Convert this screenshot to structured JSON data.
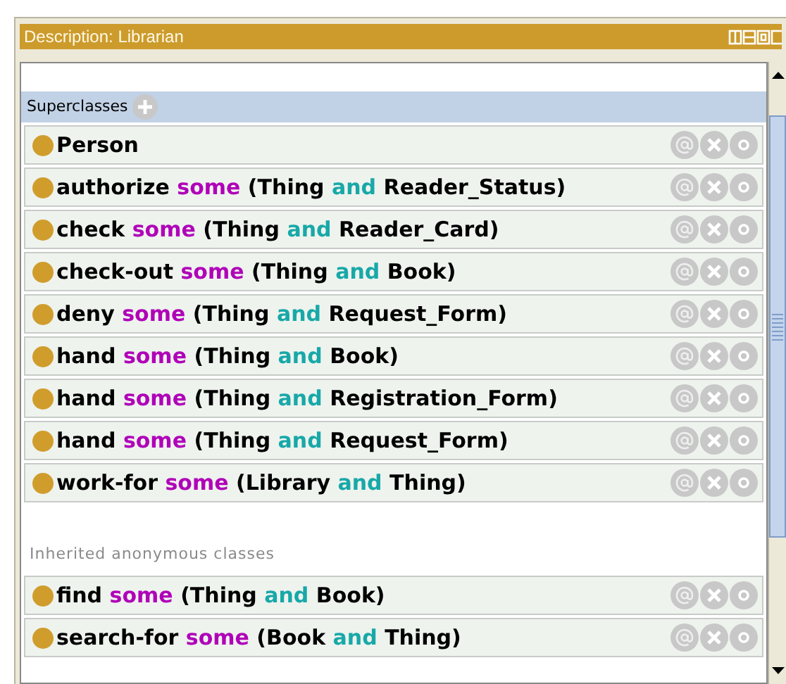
{
  "window": {
    "title": "Description: Librarian"
  },
  "sections": [
    {
      "title": "Superclasses",
      "kind": "editable",
      "rows": [
        {
          "parts": [
            {
              "text": "Person",
              "kind": "entity"
            }
          ]
        },
        {
          "parts": [
            {
              "text": "authorize",
              "kind": "entity"
            },
            {
              "text": "some",
              "kind": "restriction"
            },
            {
              "text": "(Thing",
              "kind": "entity"
            },
            {
              "text": "and",
              "kind": "connective"
            },
            {
              "text": "Reader_Status)",
              "kind": "entity"
            }
          ]
        },
        {
          "parts": [
            {
              "text": "check",
              "kind": "entity"
            },
            {
              "text": "some",
              "kind": "restriction"
            },
            {
              "text": "(Thing",
              "kind": "entity"
            },
            {
              "text": "and",
              "kind": "connective"
            },
            {
              "text": "Reader_Card)",
              "kind": "entity"
            }
          ]
        },
        {
          "parts": [
            {
              "text": "check-out",
              "kind": "entity"
            },
            {
              "text": "some",
              "kind": "restriction"
            },
            {
              "text": "(Thing",
              "kind": "entity"
            },
            {
              "text": "and",
              "kind": "connective"
            },
            {
              "text": "Book)",
              "kind": "entity"
            }
          ]
        },
        {
          "parts": [
            {
              "text": "deny",
              "kind": "entity"
            },
            {
              "text": "some",
              "kind": "restriction"
            },
            {
              "text": "(Thing",
              "kind": "entity"
            },
            {
              "text": "and",
              "kind": "connective"
            },
            {
              "text": "Request_Form)",
              "kind": "entity"
            }
          ]
        },
        {
          "parts": [
            {
              "text": "hand",
              "kind": "entity"
            },
            {
              "text": "some",
              "kind": "restriction"
            },
            {
              "text": "(Thing",
              "kind": "entity"
            },
            {
              "text": "and",
              "kind": "connective"
            },
            {
              "text": "Book)",
              "kind": "entity"
            }
          ]
        },
        {
          "parts": [
            {
              "text": "hand",
              "kind": "entity"
            },
            {
              "text": "some",
              "kind": "restriction"
            },
            {
              "text": "(Thing",
              "kind": "entity"
            },
            {
              "text": "and",
              "kind": "connective"
            },
            {
              "text": "Registration_Form)",
              "kind": "entity"
            }
          ]
        },
        {
          "parts": [
            {
              "text": "hand",
              "kind": "entity"
            },
            {
              "text": "some",
              "kind": "restriction"
            },
            {
              "text": "(Thing",
              "kind": "entity"
            },
            {
              "text": "and",
              "kind": "connective"
            },
            {
              "text": "Request_Form)",
              "kind": "entity"
            }
          ]
        },
        {
          "parts": [
            {
              "text": "work-for",
              "kind": "entity"
            },
            {
              "text": "some",
              "kind": "restriction"
            },
            {
              "text": "(Library",
              "kind": "entity"
            },
            {
              "text": "and",
              "kind": "connective"
            },
            {
              "text": "Thing)",
              "kind": "entity"
            }
          ]
        }
      ]
    },
    {
      "title": "Inherited anonymous classes",
      "kind": "inherited",
      "rows": [
        {
          "parts": [
            {
              "text": "find",
              "kind": "entity"
            },
            {
              "text": "some",
              "kind": "restriction"
            },
            {
              "text": "(Thing",
              "kind": "entity"
            },
            {
              "text": "and",
              "kind": "connective"
            },
            {
              "text": "Book)",
              "kind": "entity"
            }
          ]
        },
        {
          "parts": [
            {
              "text": "search-for",
              "kind": "entity"
            },
            {
              "text": "some",
              "kind": "restriction"
            },
            {
              "text": "(Book",
              "kind": "entity"
            },
            {
              "text": "and",
              "kind": "connective"
            },
            {
              "text": "Thing)",
              "kind": "entity"
            }
          ]
        }
      ]
    }
  ]
}
